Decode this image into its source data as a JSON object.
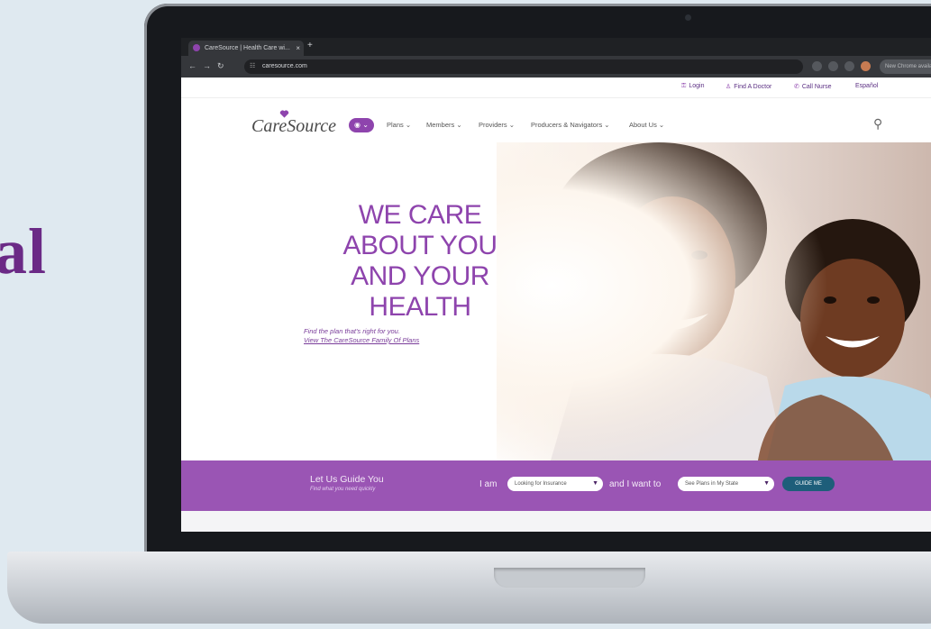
{
  "side_text": "al",
  "browser": {
    "tab_title": "CareSource | Health Care wi...",
    "tab_close": "×",
    "new_tab": "+",
    "url": "caresource.com",
    "profile_chip": "New Chrome available"
  },
  "utility_nav": {
    "login": "Login",
    "find_doctor": "Find A Doctor",
    "call_nurse": "Call Nurse",
    "language": "Español"
  },
  "main_nav": {
    "logo": "CareSource",
    "location_button": "◉ ⌄",
    "items": [
      "Plans ⌄",
      "Members ⌄",
      "Providers ⌄",
      "Producers & Navigators ⌄",
      "About Us ⌄"
    ],
    "search_icon": "⚲"
  },
  "hero": {
    "title_lines": [
      "WE CARE",
      "ABOUT YOU",
      "AND YOUR",
      "HEALTH"
    ],
    "subtitle": "Find the plan that's right for you.",
    "link": "View The CareSource Family Of Plans"
  },
  "guide": {
    "title": "Let Us Guide You",
    "subtitle": "Find what you need quickly",
    "i_am": "I am",
    "select1": "Looking for Insurance",
    "and_want": "and I want to",
    "select2": "See Plans in My State",
    "button": "GUIDE ME"
  },
  "colors": {
    "brand_purple": "#8e44ad",
    "guide_bar": "#9a55b4",
    "guide_button": "#1e5e7a",
    "side_text": "#6b2a86"
  }
}
